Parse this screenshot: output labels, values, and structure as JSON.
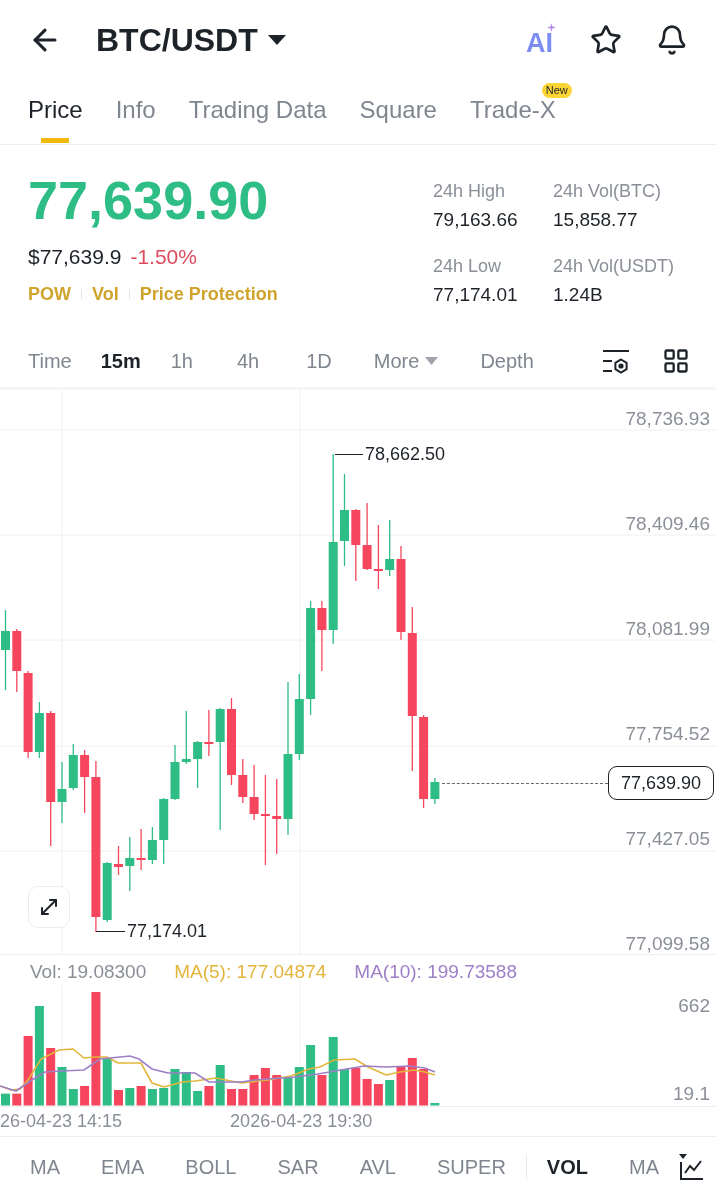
{
  "header": {
    "title": "BTC/USDT",
    "ai_label": "AI"
  },
  "tabs": [
    {
      "label": "Price",
      "selected": true
    },
    {
      "label": "Info",
      "selected": false
    },
    {
      "label": "Trading Data",
      "selected": false
    },
    {
      "label": "Square",
      "selected": false
    },
    {
      "label": "Trade-X",
      "selected": false,
      "badge": "New"
    }
  ],
  "ticker": {
    "last_price": {
      "text": "77,639.90",
      "up": true
    },
    "fiat_price": "$77,639.9",
    "change": {
      "text": "-1.50%",
      "up": false
    },
    "tags": [
      "POW",
      "Vol",
      "Price Protection"
    ],
    "stats": [
      {
        "label": "24h High",
        "value": "79,163.66"
      },
      {
        "label": "24h Vol(BTC)",
        "value": "15,858.77"
      },
      {
        "label": "24h Low",
        "value": "77,174.01"
      },
      {
        "label": "24h Vol(USDT)",
        "value": "1.24B"
      }
    ]
  },
  "intervals": [
    {
      "label": "Time",
      "selected": false,
      "dropdown": false
    },
    {
      "label": "15m",
      "selected": true,
      "dropdown": false
    },
    {
      "label": "1h",
      "selected": false,
      "dropdown": false
    },
    {
      "label": "4h",
      "selected": false,
      "dropdown": false
    },
    {
      "label": "1D",
      "selected": false,
      "dropdown": false
    },
    {
      "label": "More",
      "selected": false,
      "dropdown": true
    },
    {
      "label": "Depth",
      "selected": false,
      "dropdown": false
    }
  ],
  "chart": {
    "price_axis": [
      "78,736.93",
      "78,409.46",
      "78,081.99",
      "77,754.52",
      "77,427.05",
      "77,099.58"
    ],
    "high_label": "78,662.50",
    "low_label": "77,174.01",
    "current_price": "77,639.90"
  },
  "volume": {
    "legend": [
      {
        "text": "Vol: 19.08300",
        "color": "#8a8f98"
      },
      {
        "text": "MA(5): 177.04874",
        "color": "#e2b53b"
      },
      {
        "text": "MA(10): 199.73588",
        "color": "#9d7fc7"
      }
    ],
    "axis": [
      "662",
      "19.1"
    ],
    "time_axis": [
      "26-04-23 14:15",
      "2026-04-23 19:30"
    ]
  },
  "indicators": {
    "main": [
      {
        "label": "MA",
        "selected": false
      },
      {
        "label": "EMA",
        "selected": false
      },
      {
        "label": "BOLL",
        "selected": false
      },
      {
        "label": "SAR",
        "selected": false
      },
      {
        "label": "AVL",
        "selected": false
      },
      {
        "label": "SUPER",
        "selected": false
      }
    ],
    "sub": [
      {
        "label": "VOL",
        "selected": true
      },
      {
        "label": "MA",
        "selected": false
      }
    ]
  }
}
